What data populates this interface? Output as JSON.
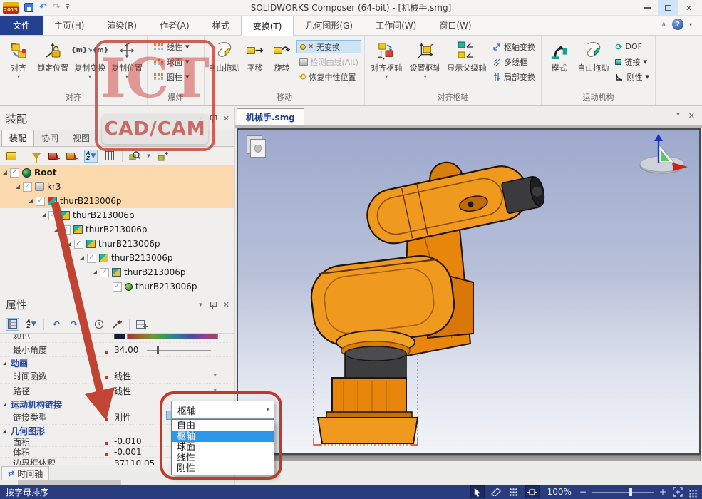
{
  "window": {
    "title": "SOLIDWORKS Composer (64-bit) - [机械手.smg]",
    "app_badge": "2015"
  },
  "menu": {
    "tabs": [
      "文件",
      "主页(H)",
      "渲染(R)",
      "作者(A)",
      "样式",
      "变换(T)",
      "几何图形(G)",
      "工作间(W)",
      "窗口(W)"
    ],
    "active_tab": "变换(T)"
  },
  "ribbon": {
    "align": {
      "label": "对齐",
      "align_btn": "对齐",
      "lock_btn": "锁定位置",
      "copy_transform_btn": "复制变换",
      "copy_position_btn": "复制位置"
    },
    "explode": {
      "label": "爆炸",
      "linear_btn": "线性",
      "spherical_btn": "球面",
      "cylindrical_btn": "圆柱"
    },
    "move": {
      "label": "移动",
      "free_drag_btn": "自由拖动",
      "translate_btn": "平移",
      "rotate_btn": "旋转",
      "no_transform_btn": "无变换",
      "detect_curve_btn": "检测曲线(Alt)",
      "restore_neutral_btn": "恢复中性位置"
    },
    "pivot": {
      "label": "对齐枢轴",
      "align_pivot_btn": "对齐枢轴",
      "set_pivot_btn": "设置枢轴",
      "show_parent_axis_btn": "显示父级轴",
      "pivot_transform_btn": "枢轴变换",
      "multi_wireframe_btn": "多线框",
      "local_transform_btn": "局部变换"
    },
    "kinematics": {
      "label": "运动机构",
      "mode_btn": "模式",
      "free_drag_btn": "自由拖动",
      "dof_btn": "DOF",
      "link_btn": "链接",
      "rigid_btn": "刚性"
    }
  },
  "assembly": {
    "title": "装配",
    "tabs": [
      "装配",
      "协同",
      "视图"
    ],
    "active_tab": "装配",
    "tree": [
      {
        "label": "Root"
      },
      {
        "label": "kr3"
      },
      {
        "label": "thurB213006p"
      },
      {
        "label": "thurB213006p"
      },
      {
        "label": "thurB213006p"
      },
      {
        "label": "thurB213006p"
      },
      {
        "label": "thurB213006p"
      },
      {
        "label": "thurB213006p"
      },
      {
        "label": "thurB213006p"
      }
    ]
  },
  "properties": {
    "title": "属性",
    "color_label": "颜色",
    "min_angle_label": "最小角度",
    "min_angle_value": "34.00",
    "animation_section": "动画",
    "time_function_label": "时间函数",
    "time_function_value": "线性",
    "path_label": "路径",
    "path_value": "线性",
    "kinematic_section": "运动机构链接",
    "link_type_label": "链接类型",
    "link_type_value": "刚性",
    "geometry_section": "几何图形",
    "area_label": "面积",
    "area_value": "-0.010",
    "volume_label": "体积",
    "volume_value": "-0.001",
    "bbox_label": "边界框体积",
    "bbox_value": "37110.05",
    "timeline_tab": "时间轴"
  },
  "popup": {
    "value": "枢轴",
    "options": [
      "自由",
      "枢轴",
      "球面",
      "线性",
      "刚性"
    ],
    "selected": "枢轴"
  },
  "viewport": {
    "tab_label": "机械手.smg"
  },
  "statusbar": {
    "sort_label": "按字母排序",
    "zoom_value": "100%"
  },
  "watermark": {
    "line1": "ICT",
    "line2": "CAD/CAM"
  },
  "icons": {
    "dropdown": "▾",
    "undo": "↶",
    "redo": "↷",
    "close": "✕",
    "collapse": "∧",
    "help": "?",
    "check": "✓",
    "scroll_up": "▲",
    "scroll_down": "▼",
    "minus": "−",
    "plus": "+",
    "copy_m": "{m}",
    "arrow_right": "→",
    "arrow_se": "↘",
    "rotate": "↷",
    "restore": "⟲",
    "dof": "⟳",
    "sort_a": "A",
    "sort_z": "Z",
    "no_transform_x": "✕",
    "timeline_arrows": "⇄"
  },
  "colors": {
    "accent_navy": "#24408e",
    "selection_blue": "#2f97e8",
    "tree_highlight": "#fcd8ad",
    "robot_orange": "#e8860c",
    "annotation_red": "#bf3a28",
    "statusbar_navy": "#2a3c80"
  }
}
